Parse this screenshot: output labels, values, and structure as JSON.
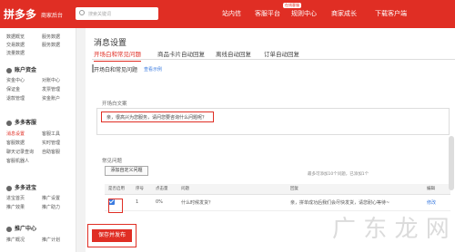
{
  "topbar": {
    "logo": "拼多多",
    "logo_sub": "商家后台",
    "search_placeholder": "搜索关键词",
    "nav": [
      "站内信",
      "客服平台",
      "规则中心",
      "商家成长",
      "下载客户端"
    ],
    "badge": "在线客服",
    "colors": {
      "brand": "#e02e24"
    }
  },
  "sidebar": {
    "top_items": [
      [
        "数据概览",
        "服务数据"
      ],
      [
        "交易数据",
        "服务数据"
      ],
      [
        "流量数据"
      ]
    ],
    "sections": [
      {
        "title": "账户资金",
        "items": [
          [
            "资金中心",
            "对账中心"
          ],
          [
            "保证金",
            "发票管理"
          ],
          [
            "退款管理",
            "资金账户"
          ]
        ]
      },
      {
        "title": "多多客服",
        "items": [
          [
            "消息设置",
            "客服工具"
          ],
          [
            "客服数据",
            "实时管理"
          ],
          [
            "聊天记录查询",
            "自助客服"
          ],
          [
            "客服机器人"
          ]
        ]
      },
      {
        "title": "多多进宝",
        "items": [
          [
            "进宝首页",
            "推广设置"
          ],
          [
            "推广效果",
            "推广助力"
          ]
        ]
      },
      {
        "title": "推广中心",
        "items": [
          [
            "推广概况",
            "推广计划"
          ]
        ]
      }
    ],
    "active_item": "消息设置"
  },
  "main": {
    "title": "消息设置",
    "tabs": [
      "开场白和常见问题",
      "商品卡片自动回复",
      "离线自动回复",
      "订单自动回复"
    ],
    "section_title": "开场白和常见问题",
    "section_link": "查看示例",
    "greeting_label": "开场白文案",
    "greeting_value": "亲，很高兴为您服务，请问您要咨询什么问题呢？",
    "faq_label": "常见问题",
    "add_faq_button": "添加自定义问题",
    "faq_hint": "最多可添加10个问题，已添加1个",
    "table": {
      "headers": [
        "是否启用",
        "序号",
        "点击量",
        "问题",
        "回复",
        "编辑"
      ],
      "rows": [
        {
          "enabled": true,
          "index": "1",
          "clicks": "0%",
          "question": "什么时候发货？",
          "reply": "亲，拼单成功后我们会尽快发货，请您耐心等待~",
          "edit": "修改"
        }
      ]
    },
    "save_button": "保存并发布"
  },
  "watermark": "广 东 龙 网"
}
